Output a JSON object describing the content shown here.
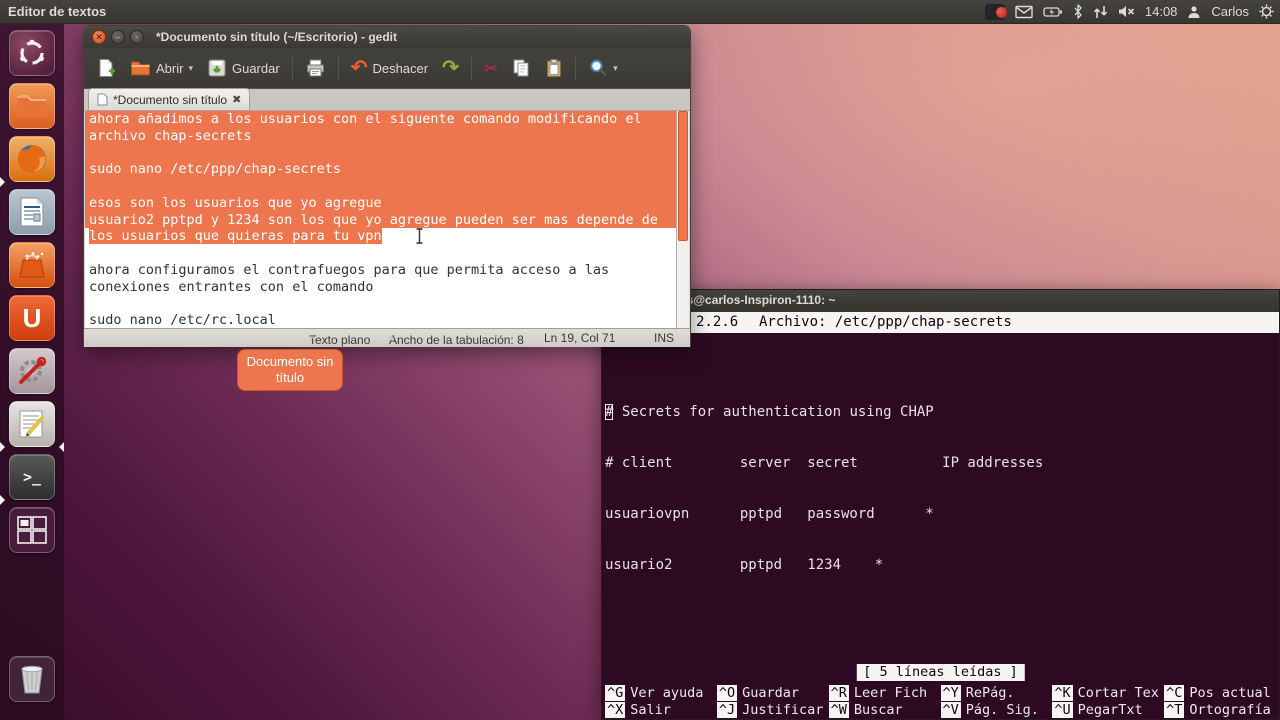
{
  "colors": {
    "accent": "#ED764E",
    "panel_bg": "#3B3A35",
    "terminal_bg": "#2E0A22",
    "selection": "#ED764E"
  },
  "panel": {
    "app_menu": "Editor de textos",
    "clock": "14:08",
    "username": "Carlos",
    "tray_icons": [
      "recorder-indicator",
      "messages-envelope",
      "battery",
      "bluetooth",
      "network-arrows",
      "volume-muted",
      "clock",
      "user",
      "session-gear"
    ]
  },
  "launcher": {
    "items": [
      "dash",
      "files",
      "firefox",
      "libreoffice-writer",
      "software-center",
      "ubuntu-one",
      "system-settings",
      "gedit",
      "terminal",
      "workspace-switcher",
      "trash"
    ],
    "terminal_glyph": ">_",
    "ubuntu_one_glyph": "U"
  },
  "gedit": {
    "title": "*Documento sin título (~/Escritorio) - gedit",
    "toolbar": {
      "open_label": "Abrir",
      "save_label": "Guardar",
      "undo_label": "Deshacer"
    },
    "tab": {
      "label": "*Documento sin título",
      "close_glyph": "✖"
    },
    "lines": [
      {
        "text": "ahora añadimos a los usuarios con el siguente comando modificando el",
        "selected": "full"
      },
      {
        "text": "archivo chap-secrets",
        "selected": "full"
      },
      {
        "text": "",
        "selected": "full"
      },
      {
        "text": "sudo nano /etc/ppp/chap-secrets",
        "selected": "full"
      },
      {
        "text": "",
        "selected": "full"
      },
      {
        "text": "esos son los usuarios que yo agregue",
        "selected": "full"
      },
      {
        "text": "usuario2 pptpd y 1234 son los que yo agregue pueden ser mas depende de",
        "selected": "full"
      },
      {
        "text": "los usuarios que quieras para tu vpn",
        "selected": "inline"
      },
      {
        "text": "",
        "selected": "none"
      },
      {
        "text": "ahora configuramos el contrafuegos para que permita acceso a las",
        "selected": "none"
      },
      {
        "text": "conexiones entrantes con el comando",
        "selected": "none"
      },
      {
        "text": "",
        "selected": "none"
      },
      {
        "text": "sudo nano /etc/rc.local",
        "selected": "none"
      }
    ],
    "statusbar": {
      "language": "Texto plano",
      "tab_width": "Ancho de la tabulación: 8",
      "position": "Ln 19, Col 71",
      "mode": "INS",
      "dropdown_caret": "▾"
    }
  },
  "tooltip": {
    "line1": "Documento sin",
    "line2": "título"
  },
  "terminal": {
    "title": "los@carlos-Inspiron-1110: ~",
    "nano": {
      "version_visible": "2.2.6",
      "file_label": "Archivo: /etc/ppp/chap-secrets",
      "cursor_char": "#",
      "line1_rest": " Secrets for authentication using CHAP",
      "line2": "# client        server  secret          IP addresses",
      "line3": "usuariovpn      pptpd   password      *",
      "line4": "usuario2        pptpd   1234    *",
      "message": "[ 5 líneas leídas ]",
      "shortcuts_row1": [
        {
          "key": "^G",
          "label": "Ver ayuda"
        },
        {
          "key": "^O",
          "label": "Guardar"
        },
        {
          "key": "^R",
          "label": "Leer Fich"
        },
        {
          "key": "^Y",
          "label": "RePág."
        },
        {
          "key": "^K",
          "label": "Cortar Tex"
        },
        {
          "key": "^C",
          "label": "Pos actual"
        }
      ],
      "shortcuts_row2": [
        {
          "key": "^X",
          "label": "Salir"
        },
        {
          "key": "^J",
          "label": "Justificar"
        },
        {
          "key": "^W",
          "label": "Buscar"
        },
        {
          "key": "^V",
          "label": "Pág. Sig."
        },
        {
          "key": "^U",
          "label": "PegarTxt"
        },
        {
          "key": "^T",
          "label": "Ortografía"
        }
      ]
    }
  }
}
